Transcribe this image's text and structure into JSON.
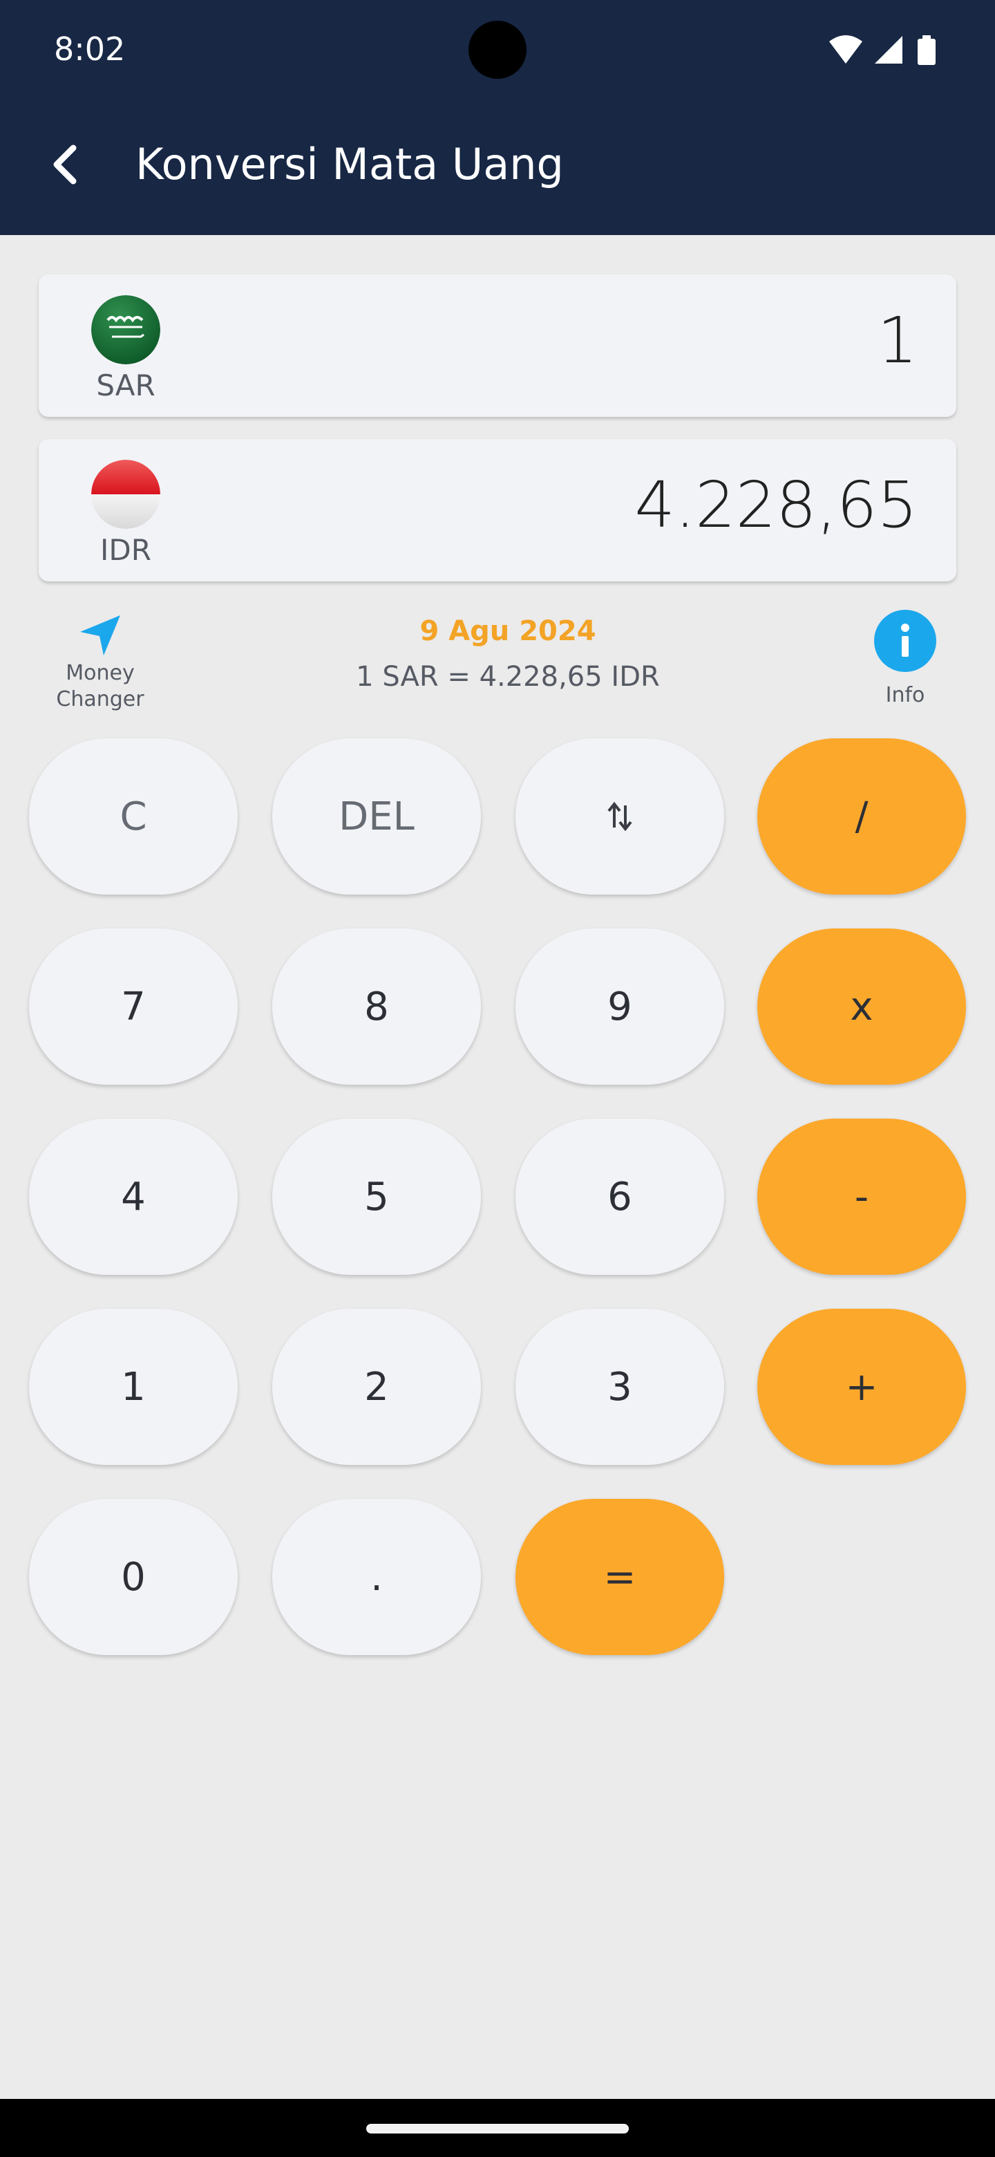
{
  "status_bar": {
    "time": "8:02",
    "icons": [
      "wifi-icon",
      "signal-icon",
      "battery-icon"
    ]
  },
  "app_bar": {
    "title": "Konversi Mata Uang",
    "back_icon": "arrow-back-icon"
  },
  "from_currency": {
    "code": "SAR",
    "amount": "1",
    "flag": "saudi-arabia-flag-icon"
  },
  "to_currency": {
    "code": "IDR",
    "amount": "4.228,65",
    "flag": "indonesia-flag-icon"
  },
  "money_changer": {
    "label_line1": "Money",
    "label_line2": "Changer",
    "icon": "navigation-arrow-icon"
  },
  "rate_info": {
    "date": "9 Agu 2024",
    "rate": "1 SAR = 4.228,65 IDR"
  },
  "info_button": {
    "label": "Info",
    "icon": "info-icon"
  },
  "keypad": {
    "clear": "C",
    "delete": "DEL",
    "swap_icon": "swap-vertical-icon",
    "divide": "/",
    "seven": "7",
    "eight": "8",
    "nine": "9",
    "multiply": "x",
    "four": "4",
    "five": "5",
    "six": "6",
    "minus": "-",
    "one": "1",
    "two": "2",
    "three": "3",
    "plus": "+",
    "zero": "0",
    "dot": ".",
    "equals": "="
  },
  "colors": {
    "app_bar": "#172744",
    "accent": "#fca82b",
    "date_text": "#f3a326",
    "info": "#1ba7ec",
    "money_changer_icon": "#1ba7ec",
    "background": "#ebebeb",
    "key": "#f2f3f7"
  }
}
